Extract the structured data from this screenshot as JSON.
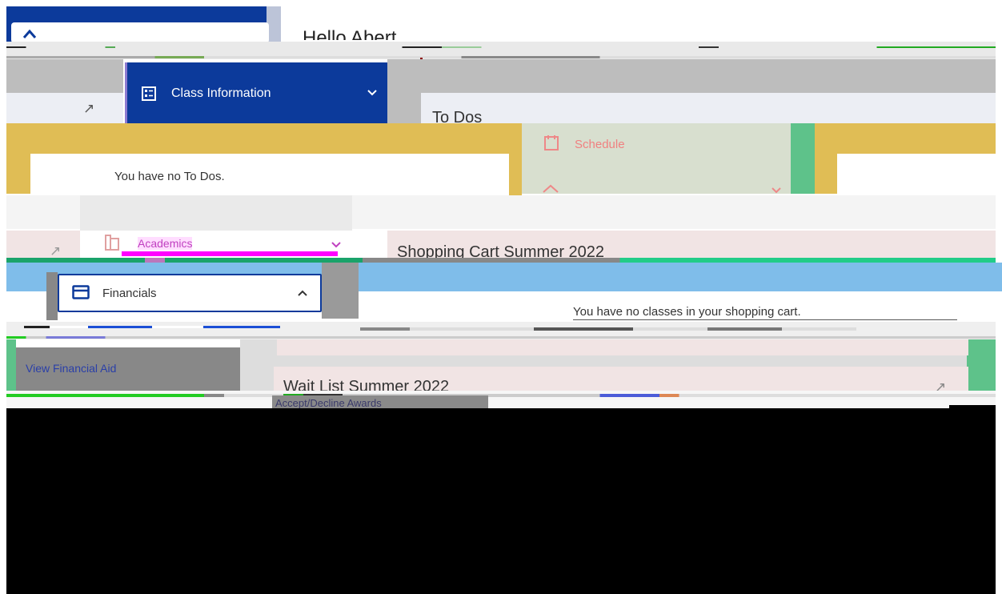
{
  "colors": {
    "nav_blue": "#0c3a9b",
    "gold": "#e0bd55",
    "sage": "#d8dfcf",
    "green": "#5ec28a",
    "sky": "#7fbdea",
    "pink_tint": "#f1e4e4",
    "magenta": "#ff00ff",
    "bar_gray": "#bdbdbd",
    "black": "#000000"
  },
  "header": {
    "greeting": "Hello Abert..."
  },
  "nav": {
    "class_information": "Class Information",
    "schedule": "Schedule",
    "academics": "Academics",
    "financials": "Financials",
    "view_financial_aid": "View Financial Aid",
    "accept_decline_awards": "Accept/Decline Awards"
  },
  "cards": {
    "todos_title": "To Dos",
    "todos_empty": "You have no To Dos.",
    "shopping_cart_title": "Shopping Cart Summer 2022",
    "shopping_cart_empty": "You have no classes in your shopping cart.",
    "wait_list_title": "Wait List Summer 2022"
  },
  "icons": {
    "class_info": "list-details-icon",
    "schedule": "calendar-icon",
    "academics": "book-icon",
    "financials": "credit-card-icon",
    "chevron_down": "chevron-down-icon",
    "chevron_up": "chevron-up-icon",
    "external": "launch-icon"
  }
}
